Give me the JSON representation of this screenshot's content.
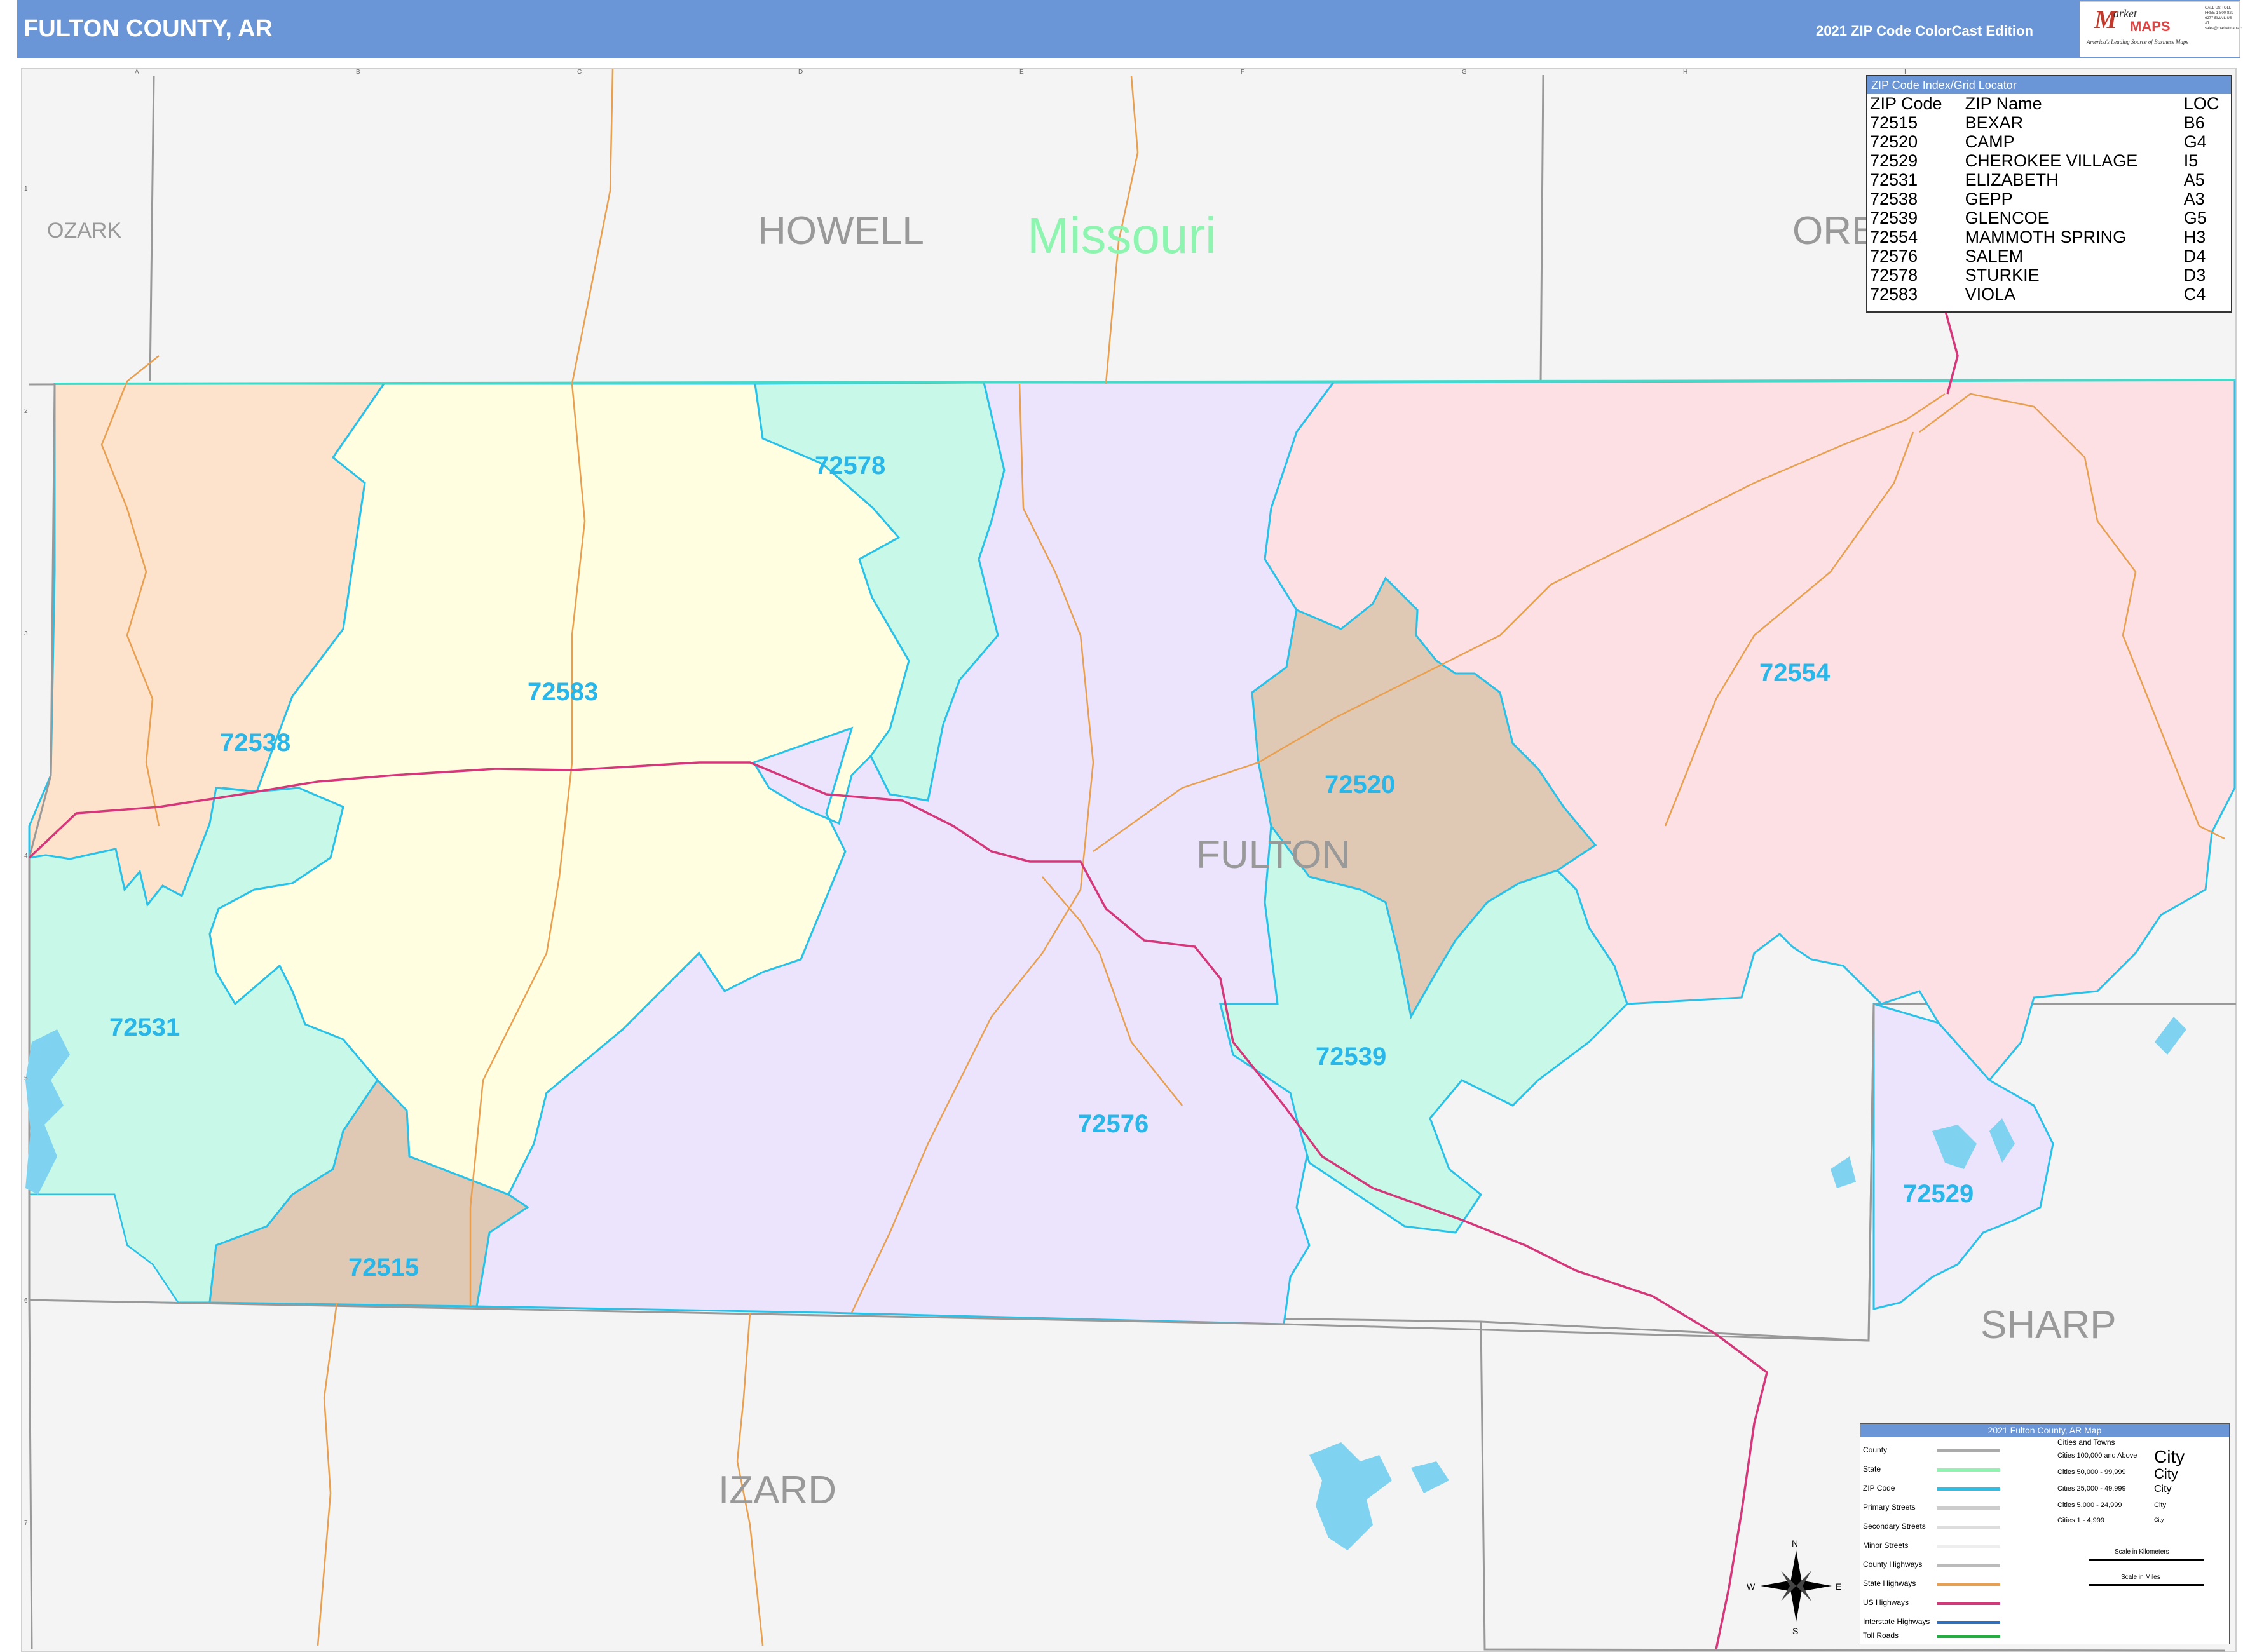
{
  "header": {
    "title": "FULTON COUNTY, AR",
    "edition": "2021 ZIP Code ColorCast Edition"
  },
  "logo": {
    "mark": "M",
    "word1": "arket",
    "word2": "MAPS",
    "tagline": "America's Leading Source of Business Maps",
    "contact": "CALL US TOLL FREE 1-800-829-6277 EMAIL US AT sales@marketmaps.com"
  },
  "colors": {
    "header": "#6a96d8",
    "zip_label": "#29b6e8",
    "zip_border": "#29c1e8",
    "state_line": "#48d8c8",
    "county_line": "#999999",
    "county_label": "#999999",
    "state_label": "#8ef5b0",
    "highway": "#d4387a",
    "road": "#e8a050",
    "lake": "#7fd3f0",
    "outside": "#f4f4f4"
  },
  "labels": {
    "counties": [
      "OZARK",
      "HOWELL",
      "ORE",
      "FULTON",
      "SHARP",
      "IZARD"
    ],
    "state": "Missouri"
  },
  "zips": [
    {
      "code": "72578",
      "color": "#c8f8e8"
    },
    {
      "code": "72583",
      "color": "#fffee0"
    },
    {
      "code": "72538",
      "color": "#fde2cc"
    },
    {
      "code": "72554",
      "color": "#fde0e4"
    },
    {
      "code": "72520",
      "color": "#e0c9b4"
    },
    {
      "code": "72531",
      "color": "#c8f8e8"
    },
    {
      "code": "72539",
      "color": "#c8f8e8"
    },
    {
      "code": "72576",
      "color": "#ebe4fc"
    },
    {
      "code": "72515",
      "color": "#e0c9b4"
    },
    {
      "code": "72529",
      "color": "#ebe4fc"
    }
  ],
  "zip_index": {
    "title": "ZIP Code Index/Grid Locator",
    "columns": [
      "ZIP Code",
      "ZIP Name",
      "LOC"
    ],
    "rows": [
      [
        "72515",
        "BEXAR",
        "B6"
      ],
      [
        "72520",
        "CAMP",
        "G4"
      ],
      [
        "72529",
        "CHEROKEE VILLAGE",
        "I5"
      ],
      [
        "72531",
        "ELIZABETH",
        "A5"
      ],
      [
        "72538",
        "GEPP",
        "A3"
      ],
      [
        "72539",
        "GLENCOE",
        "G5"
      ],
      [
        "72554",
        "MAMMOTH SPRING",
        "H3"
      ],
      [
        "72576",
        "SALEM",
        "D4"
      ],
      [
        "72578",
        "STURKIE",
        "D3"
      ],
      [
        "72583",
        "VIOLA",
        "C4"
      ]
    ]
  },
  "legend": {
    "title": "2021 Fulton County, AR Map",
    "items": [
      {
        "label": "County",
        "color": "#aaaaaa"
      },
      {
        "label": "State",
        "color": "#8ef5b0"
      },
      {
        "label": "ZIP Code",
        "color": "#29c1e8"
      },
      {
        "label": "Primary Streets",
        "color": "#cccccc"
      },
      {
        "label": "Secondary Streets",
        "color": "#dddddd"
      },
      {
        "label": "Minor Streets",
        "color": "#eeeeee"
      },
      {
        "label": "County Highways",
        "color": "#bbbbbb"
      },
      {
        "label": "State Highways",
        "color": "#e8a050"
      },
      {
        "label": "US Highways",
        "color": "#d4387a"
      },
      {
        "label": "Interstate Highways",
        "color": "#3070c0"
      },
      {
        "label": "Toll Roads",
        "color": "#20b040"
      }
    ],
    "cities_title": "Cities and Towns",
    "cities": [
      {
        "range": "Cities 100,000 and Above",
        "sample": "City"
      },
      {
        "range": "Cities 50,000 - 99,999",
        "sample": "City"
      },
      {
        "range": "Cities 25,000 - 49,999",
        "sample": "City"
      },
      {
        "range": "Cities 5,000 - 24,999",
        "sample": "City"
      },
      {
        "range": "Cities 1 - 4,999",
        "sample": "City"
      }
    ],
    "scale_km": "Scale in Kilometers",
    "scale_mi": "Scale in Miles"
  },
  "compass": {
    "n": "N",
    "s": "S",
    "e": "E",
    "w": "W"
  },
  "grid": {
    "columns": [
      "A",
      "B",
      "C",
      "D",
      "E",
      "F",
      "G",
      "H",
      "I"
    ],
    "rows": [
      "1",
      "2",
      "3",
      "4",
      "5",
      "6",
      "7"
    ]
  }
}
